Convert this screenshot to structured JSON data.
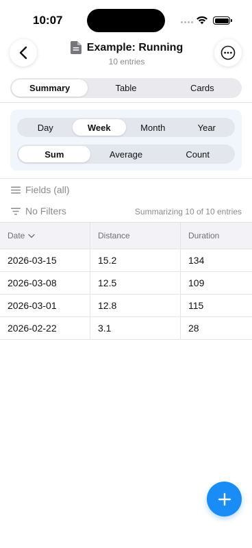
{
  "status": {
    "time": "10:07"
  },
  "header": {
    "title": "Example: Running",
    "subtitle": "10 entries"
  },
  "view_tabs": [
    {
      "label": "Summary",
      "active": true
    },
    {
      "label": "Table",
      "active": false
    },
    {
      "label": "Cards",
      "active": false
    }
  ],
  "period_tabs": [
    {
      "label": "Day",
      "active": false
    },
    {
      "label": "Week",
      "active": true
    },
    {
      "label": "Month",
      "active": false
    },
    {
      "label": "Year",
      "active": false
    }
  ],
  "aggregate_tabs": [
    {
      "label": "Sum",
      "active": true
    },
    {
      "label": "Average",
      "active": false
    },
    {
      "label": "Count",
      "active": false
    }
  ],
  "fields_label": "Fields (all)",
  "filters_label": "No Filters",
  "summary_text": "Summarizing 10 of 10 entries",
  "table": {
    "columns": [
      "Date",
      "Distance",
      "Duration"
    ],
    "rows": [
      [
        "2026-03-15",
        "15.2",
        "134"
      ],
      [
        "2026-03-08",
        "12.5",
        "109"
      ],
      [
        "2026-03-01",
        "12.8",
        "115"
      ],
      [
        "2026-02-22",
        "3.1",
        "28"
      ]
    ]
  },
  "icons": {
    "back": "chevron-left-icon",
    "more": "ellipsis-circle-icon",
    "document": "document-icon",
    "fields": "lines-icon",
    "filter": "filter-icon",
    "sort": "chevron-down-icon",
    "add": "plus-icon"
  },
  "colors": {
    "accent": "#1a8cf5",
    "panel": "#f0f6fc"
  }
}
